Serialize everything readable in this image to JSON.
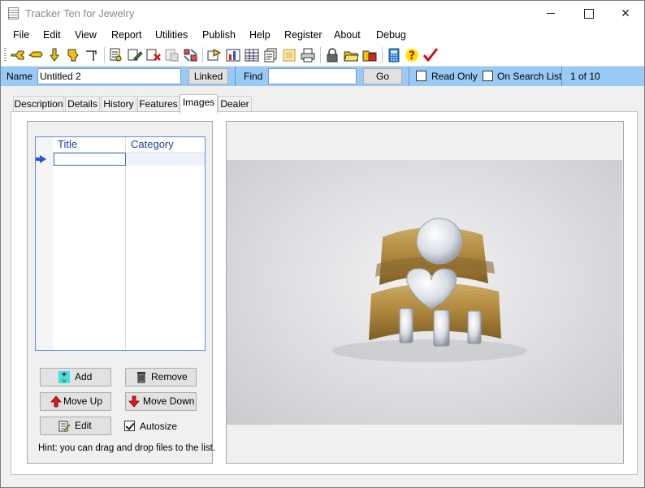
{
  "window": {
    "title": "Tracker Ten for Jewelry",
    "controls": {
      "minimize": "",
      "maximize": "",
      "close": "✕"
    }
  },
  "menu": [
    "File",
    "Edit",
    "View",
    "Report",
    "Utilities",
    "Publish",
    "Help",
    "Register",
    "About",
    "Debug"
  ],
  "toolbar": {
    "icons": [
      "first-record-icon",
      "previous-record-icon",
      "next-record-icon",
      "last-record-icon",
      "new-record-icon",
      "copy-record-icon",
      "edit-record-icon",
      "delete-record-icon",
      "filter-icon",
      "sort-icon",
      "export-icon",
      "chart-icon",
      "table-view-icon",
      "form-view-icon",
      "picture-icon",
      "print-icon",
      "lock-icon",
      "open-folder-icon",
      "save-icon",
      "calculator-icon",
      "help-icon",
      "check-icon"
    ]
  },
  "searchbar": {
    "name_label": "Name",
    "name_value": "Untitled 2",
    "linked_label": "Linked",
    "find_label": "Find",
    "find_value": "",
    "go_label": "Go",
    "read_only_label": "Read Only",
    "read_only_checked": false,
    "search_list_label": "On Search List",
    "search_list_checked": false,
    "record_position": "1 of 10",
    "bar_color": "#99c9f5"
  },
  "tabs": [
    {
      "label": "Description",
      "active": false
    },
    {
      "label": "Details",
      "active": false
    },
    {
      "label": "History",
      "active": false
    },
    {
      "label": "Features",
      "active": false
    },
    {
      "label": "Images",
      "active": true
    },
    {
      "label": "Dealer",
      "active": false
    }
  ],
  "images_tab": {
    "grid": {
      "columns": [
        "Title",
        "Category"
      ],
      "rows": [
        {
          "title": "",
          "category": ""
        }
      ]
    },
    "buttons": {
      "add": "Add",
      "remove": "Remove",
      "move_up": "Move Up",
      "move_down": "Move Down",
      "edit": "Edit"
    },
    "autosize_label": "Autosize",
    "autosize_checked": true,
    "hint": "Hint: you can drag and drop files to the list."
  },
  "preview": {
    "subject": "gold-mesh-diamond-rings-photo"
  }
}
